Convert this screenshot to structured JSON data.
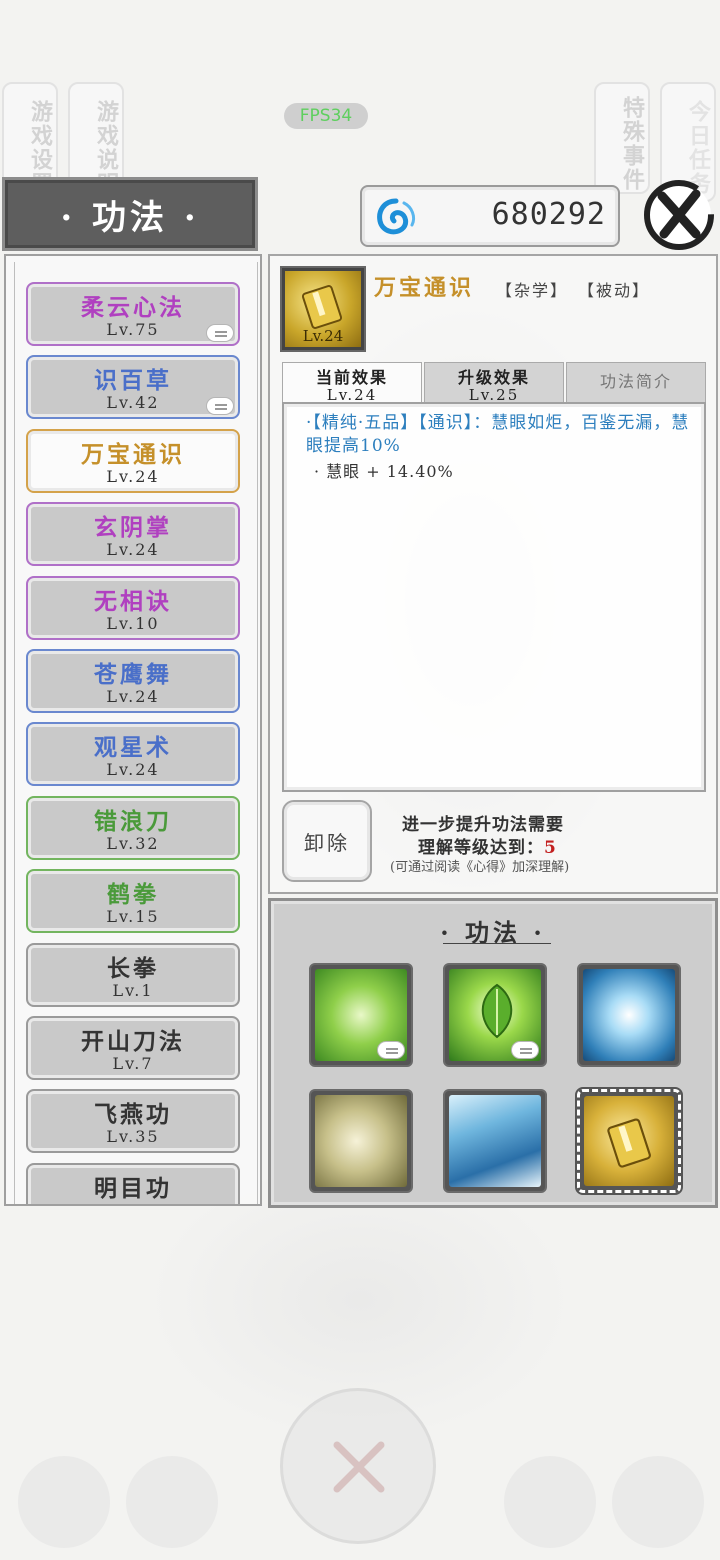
{
  "side_tabs": {
    "game_settings": "游戏设置",
    "game_guide": "游戏说明",
    "special_events": "特殊事件",
    "daily_tasks": "今日任务"
  },
  "fps": "FPS34",
  "title": "· 功法 ·",
  "currency": {
    "value": "680292",
    "icon": "swirl-coin-icon"
  },
  "skills_list": [
    {
      "name": "柔云心法",
      "level": "Lv.75",
      "color": "#b040c0",
      "border": "#b070c8",
      "badge": true
    },
    {
      "name": "识百草",
      "level": "Lv.42",
      "color": "#4a6fc9",
      "border": "#6a88cf",
      "badge": true
    },
    {
      "name": "万宝通识",
      "level": "Lv.24",
      "color": "#c5902a",
      "border": "#d4a24a",
      "badge": false,
      "selected": true
    },
    {
      "name": "玄阴掌",
      "level": "Lv.24",
      "color": "#b040c0",
      "border": "#b070c8",
      "badge": false
    },
    {
      "name": "无相诀",
      "level": "Lv.10",
      "color": "#b040c0",
      "border": "#b070c8",
      "badge": false
    },
    {
      "name": "苍鹰舞",
      "level": "Lv.24",
      "color": "#4a6fc9",
      "border": "#6a88cf",
      "badge": false
    },
    {
      "name": "观星术",
      "level": "Lv.24",
      "color": "#4a6fc9",
      "border": "#6a88cf",
      "badge": false
    },
    {
      "name": "错浪刀",
      "level": "Lv.32",
      "color": "#4a9a3a",
      "border": "#73b55f",
      "badge": false
    },
    {
      "name": "鹤拳",
      "level": "Lv.15",
      "color": "#4a9a3a",
      "border": "#73b55f",
      "badge": false
    },
    {
      "name": "长拳",
      "level": "Lv.1",
      "color": "#333333",
      "border": "#9a9a9a",
      "badge": false
    },
    {
      "name": "开山刀法",
      "level": "Lv.7",
      "color": "#333333",
      "border": "#9a9a9a",
      "badge": false
    },
    {
      "name": "飞燕功",
      "level": "Lv.35",
      "color": "#333333",
      "border": "#9a9a9a",
      "badge": false
    },
    {
      "name": "明目功",
      "level": "",
      "color": "#333333",
      "border": "#9a9a9a",
      "badge": false
    }
  ],
  "detail": {
    "name": "万宝通识",
    "icon_level": "Lv.24",
    "tag_category": "【杂学】",
    "tag_type": "【被动】",
    "tabs": {
      "current_label": "当前效果",
      "current_level": "Lv.24",
      "upgrade_label": "升级效果",
      "upgrade_level": "Lv.25",
      "intro_label": "功法简介"
    },
    "effect_text": "·【精纯·五品】【通识】：慧眼如炬，百鉴无漏，慧眼提高10%",
    "effect_stat": "· 慧眼 + 14.40%",
    "unequip_label": "卸除",
    "requirement_line1": "进一步提升功法需要",
    "requirement_line2": "理解等级达到：",
    "requirement_value": "5",
    "requirement_hint": "(可通过阅读《心得》加深理解)"
  },
  "equipped": {
    "title": "· 功法 ·",
    "slots": [
      "green-swirl-skill-icon",
      "leaf-skill-icon",
      "ice-burst-skill-icon",
      "crane-wing-skill-icon",
      "wave-skill-icon",
      "golden-book-skill-icon"
    ]
  }
}
